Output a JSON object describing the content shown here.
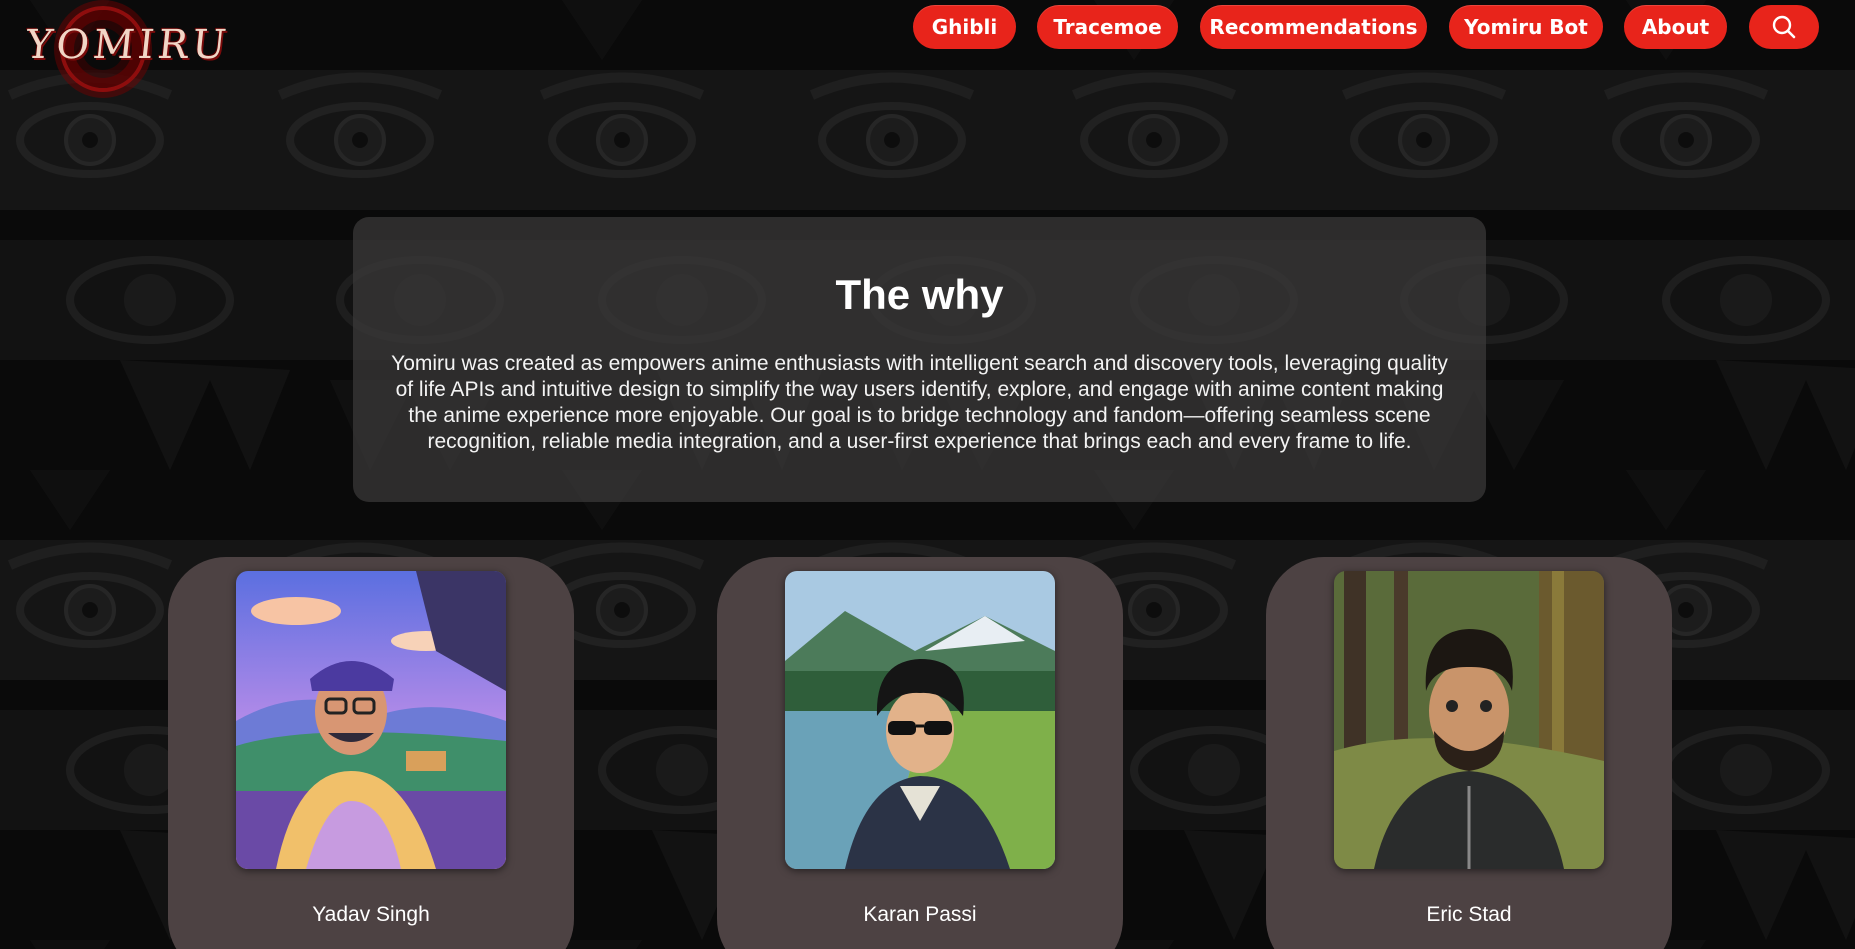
{
  "brand": {
    "logo_text": "YOMIRU",
    "accent_color": "#e8241b"
  },
  "nav": {
    "items": [
      {
        "label": "Ghibli"
      },
      {
        "label": "Tracemoe"
      },
      {
        "label": "Recommendations"
      },
      {
        "label": "Yomiru Bot"
      },
      {
        "label": "About"
      }
    ],
    "search_icon": "search-icon"
  },
  "why": {
    "title": "The why",
    "body": "Yomiru was created as empowers anime enthusiasts with intelligent search and discovery tools, leveraging quality of life APIs and intuitive design to simplify the way users identify, explore, and engage with anime content making the anime experience more enjoyable. Our goal is to bridge technology and fandom—offering seamless scene recognition, reliable media integration, and a user-first experience that brings each and every frame to life."
  },
  "team": [
    {
      "name": "Yadav Singh"
    },
    {
      "name": "Karan Passi"
    },
    {
      "name": "Eric Stad"
    }
  ],
  "colors": {
    "page_bg": "#0c0c0c",
    "panel_bg": "#3c3a3a",
    "card_bg": "#4d4243"
  }
}
